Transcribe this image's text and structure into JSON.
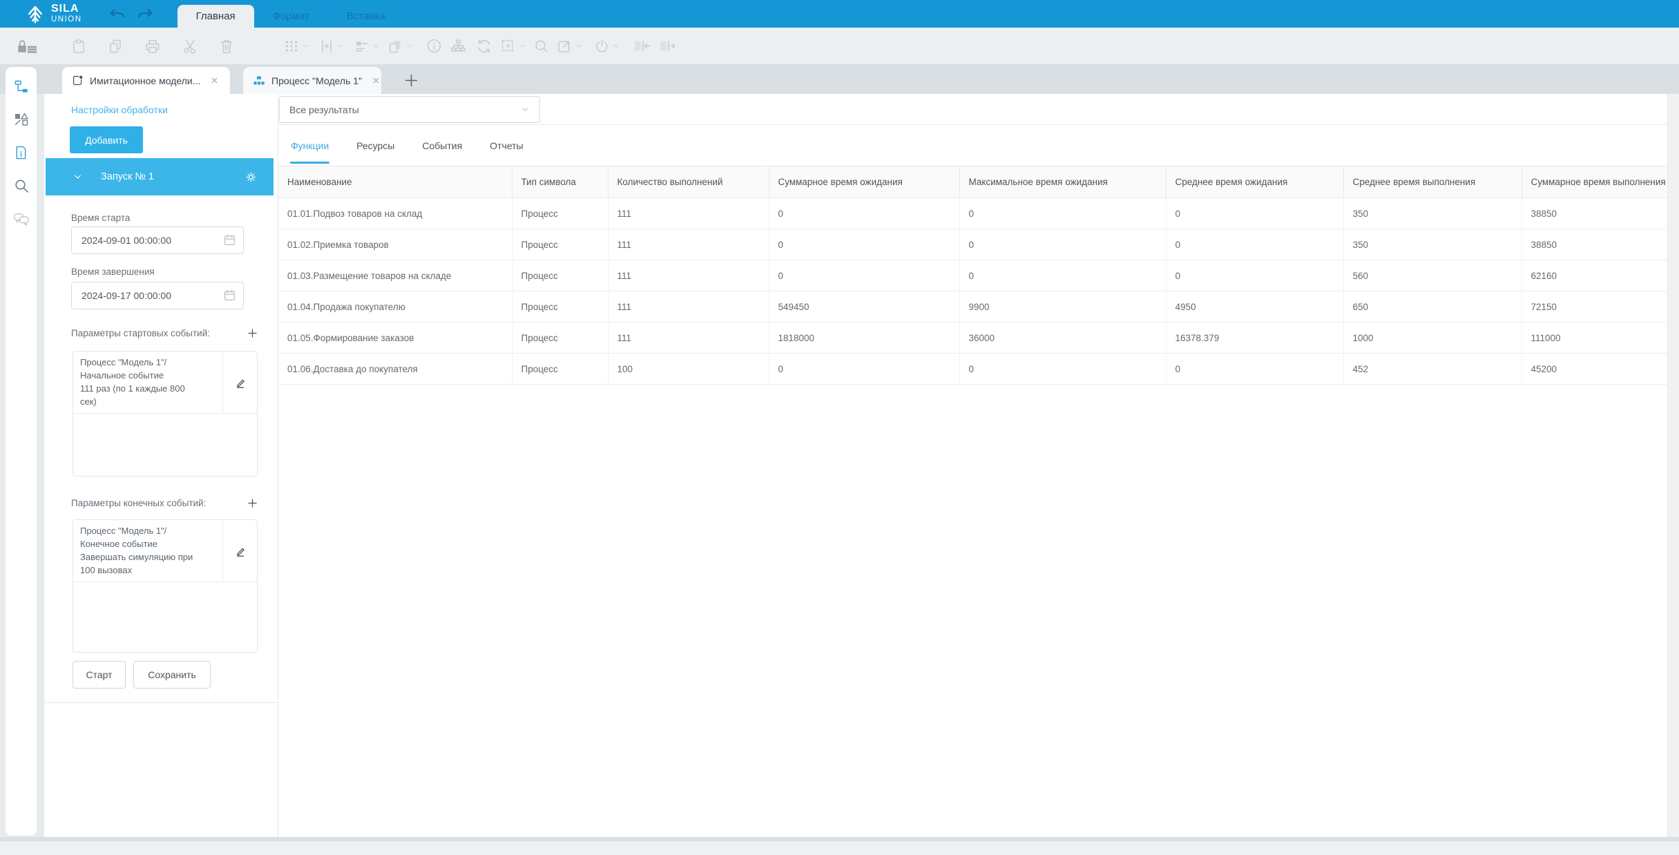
{
  "topbar": {
    "logo": {
      "line1": "SILA",
      "line2": "UNION"
    },
    "menu_tabs": [
      {
        "label": "Главная",
        "active": true
      },
      {
        "label": "Формат",
        "active": false
      },
      {
        "label": "Вставка",
        "active": false
      }
    ]
  },
  "toolbar": {
    "icons": [
      "lock-list",
      "paste",
      "copy",
      "print",
      "cut",
      "delete",
      "grid-dots",
      "insert-plus",
      "align",
      "layers",
      "info",
      "hierarchy",
      "refresh",
      "select-area",
      "zoom-search",
      "open-external",
      "power",
      "collapse-left",
      "collapse-right"
    ]
  },
  "doc_tabs": {
    "tabs": [
      {
        "label": "Имитационное модели...",
        "icon": "simulation",
        "active": true
      },
      {
        "label": "Процесс \"Модель 1\"",
        "icon": "process-diagram",
        "active": false
      }
    ]
  },
  "sidebar_rail": {
    "icons": [
      "model-tree",
      "shapes",
      "document-info",
      "search",
      "comments"
    ]
  },
  "settings_panel": {
    "link": "Настройки обработки",
    "add_button": "Добавить",
    "run_header": "Запуск № 1",
    "start_time_label": "Время старта",
    "start_time_value": "2024-09-01 00:00:00",
    "end_time_label": "Время завершения",
    "end_time_value": "2024-09-17 00:00:00",
    "start_events_label": "Параметры стартовых событий:",
    "start_event_item": "Процесс \"Модель 1\"/\nНачальное событие\n111 раз (по 1 каждые 800\nсек)",
    "end_events_label": "Параметры конечных событий:",
    "end_event_item": "Процесс \"Модель 1\"/\nКонечное событие\nЗавершать симуляцию при\n100 вызовах",
    "start_button": "Старт",
    "save_button": "Сохранить"
  },
  "results": {
    "filter_value": "Все результаты",
    "tabs": [
      {
        "label": "Функции",
        "active": true
      },
      {
        "label": "Ресурсы",
        "active": false
      },
      {
        "label": "События",
        "active": false
      },
      {
        "label": "Отчеты",
        "active": false
      }
    ],
    "table": {
      "columns": [
        "Наименование",
        "Тип символа",
        "Количество выполнений",
        "Суммарное время ожидания",
        "Максимальное время ожидания",
        "Среднее время ожидания",
        "Среднее время выполнения",
        "Суммарное время выполнения"
      ],
      "rows": [
        [
          "01.01.Подвоз товаров на склад",
          "Процесс",
          "111",
          "0",
          "0",
          "0",
          "350",
          "38850"
        ],
        [
          "01.02.Приемка товаров",
          "Процесс",
          "111",
          "0",
          "0",
          "0",
          "350",
          "38850"
        ],
        [
          "01.03.Размещение товаров на складе",
          "Процесс",
          "111",
          "0",
          "0",
          "0",
          "560",
          "62160"
        ],
        [
          "01.04.Продажа покупателю",
          "Процесс",
          "111",
          "549450",
          "9900",
          "4950",
          "650",
          "72150"
        ],
        [
          "01.05.Формирование заказов",
          "Процесс",
          "111",
          "1818000",
          "36000",
          "16378.379",
          "1000",
          "111000"
        ],
        [
          "01.06.Доставка до покупателя",
          "Процесс",
          "100",
          "0",
          "0",
          "0",
          "452",
          "45200"
        ]
      ]
    }
  },
  "colors": {
    "topbar_blue": "#1697d5",
    "accent_blue": "#3cb6e9",
    "link_blue": "#45b4e6",
    "active_tab_blue": "#3aabdf"
  }
}
